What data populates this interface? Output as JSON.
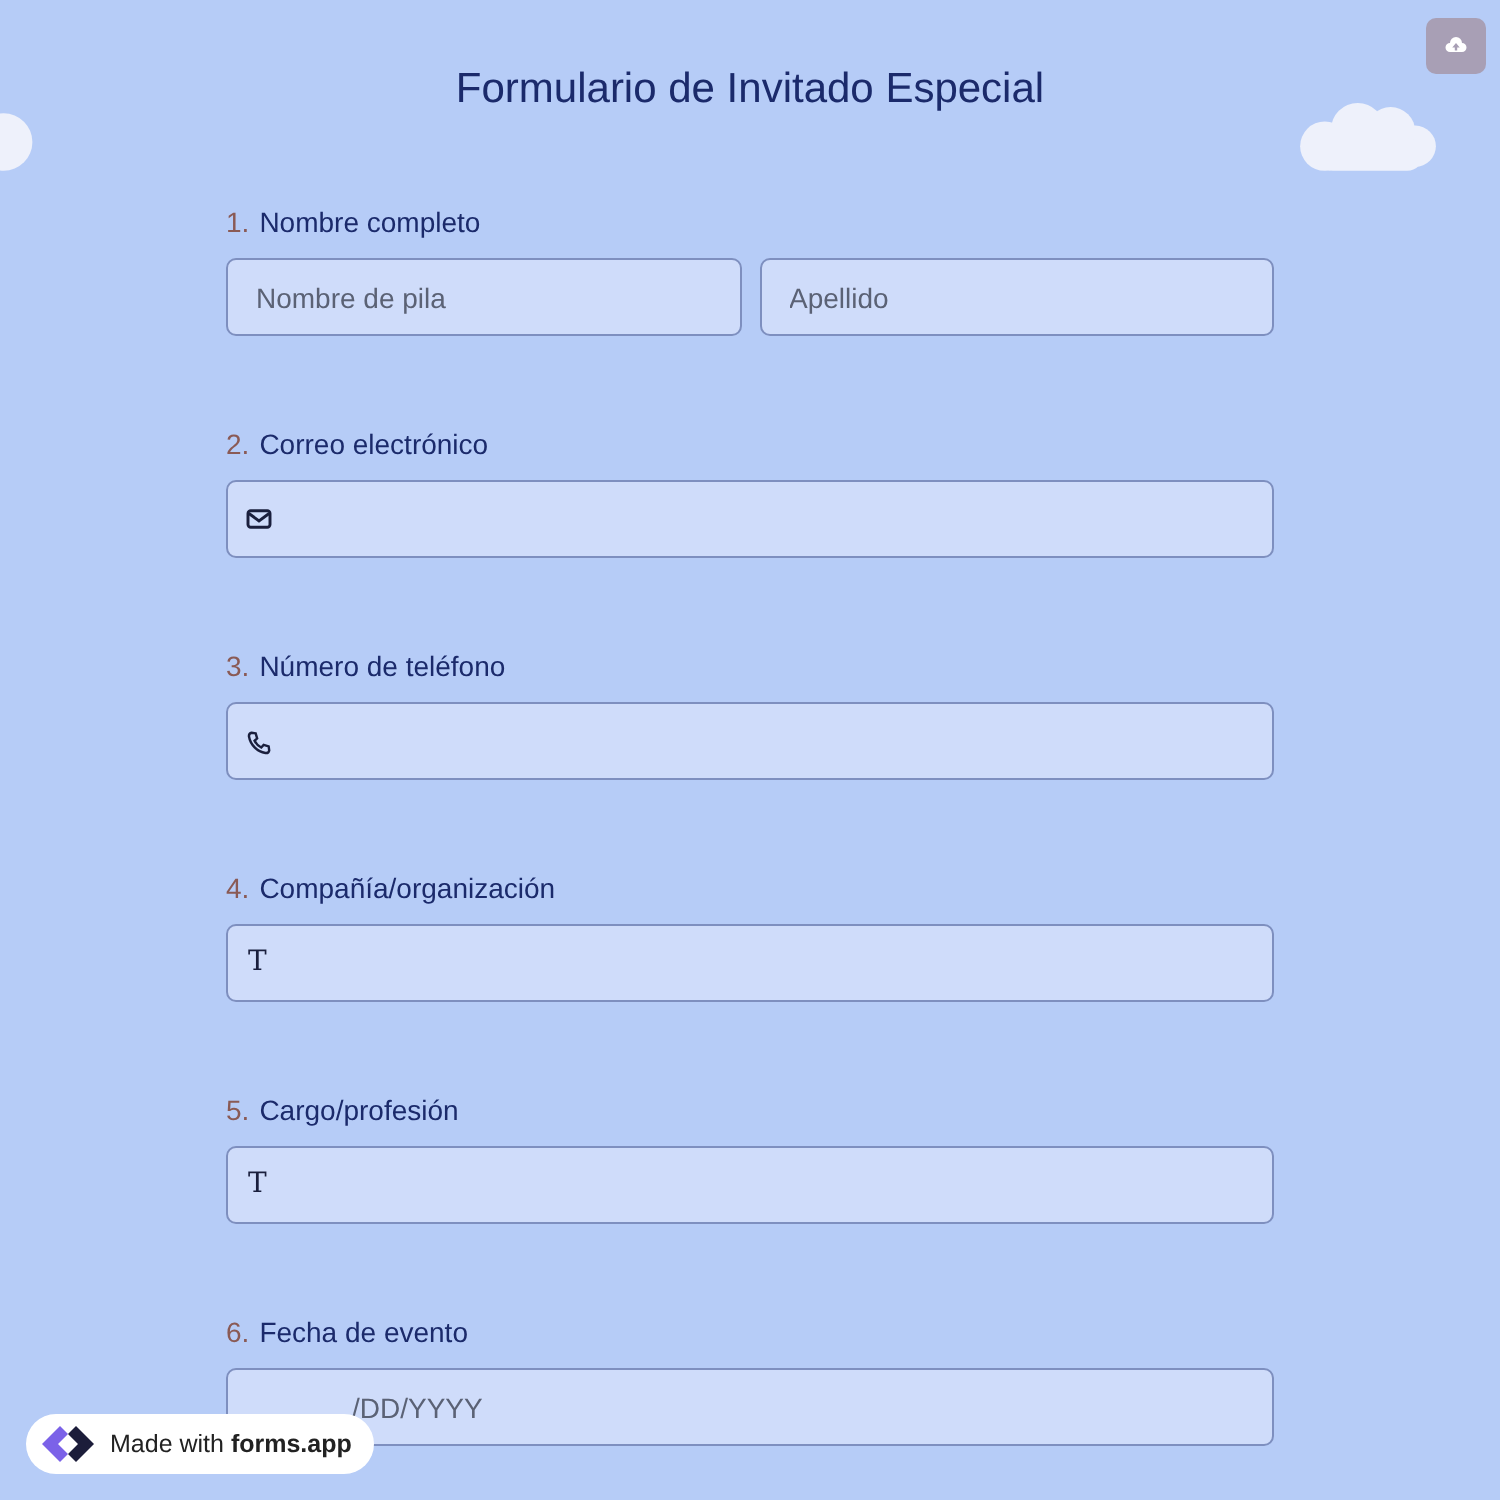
{
  "title": "Formulario de Invitado Especial",
  "questions": [
    {
      "number": "1.",
      "label": "Nombre completo",
      "kind": "names",
      "fields": [
        {
          "placeholder": "Nombre de pila"
        },
        {
          "placeholder": "Apellido"
        }
      ]
    },
    {
      "number": "2.",
      "label": "Correo electrónico",
      "kind": "email"
    },
    {
      "number": "3.",
      "label": "Número de teléfono",
      "kind": "phone"
    },
    {
      "number": "4.",
      "label": "Compañía/organización",
      "kind": "text",
      "icon": "T"
    },
    {
      "number": "5.",
      "label": "Cargo/profesión",
      "kind": "text",
      "icon": "T"
    },
    {
      "number": "6.",
      "label": "Fecha de evento",
      "kind": "date",
      "placeholder": "/DD/YYYY"
    }
  ],
  "badge": {
    "prefix": "Made with",
    "brand": "forms.app"
  }
}
